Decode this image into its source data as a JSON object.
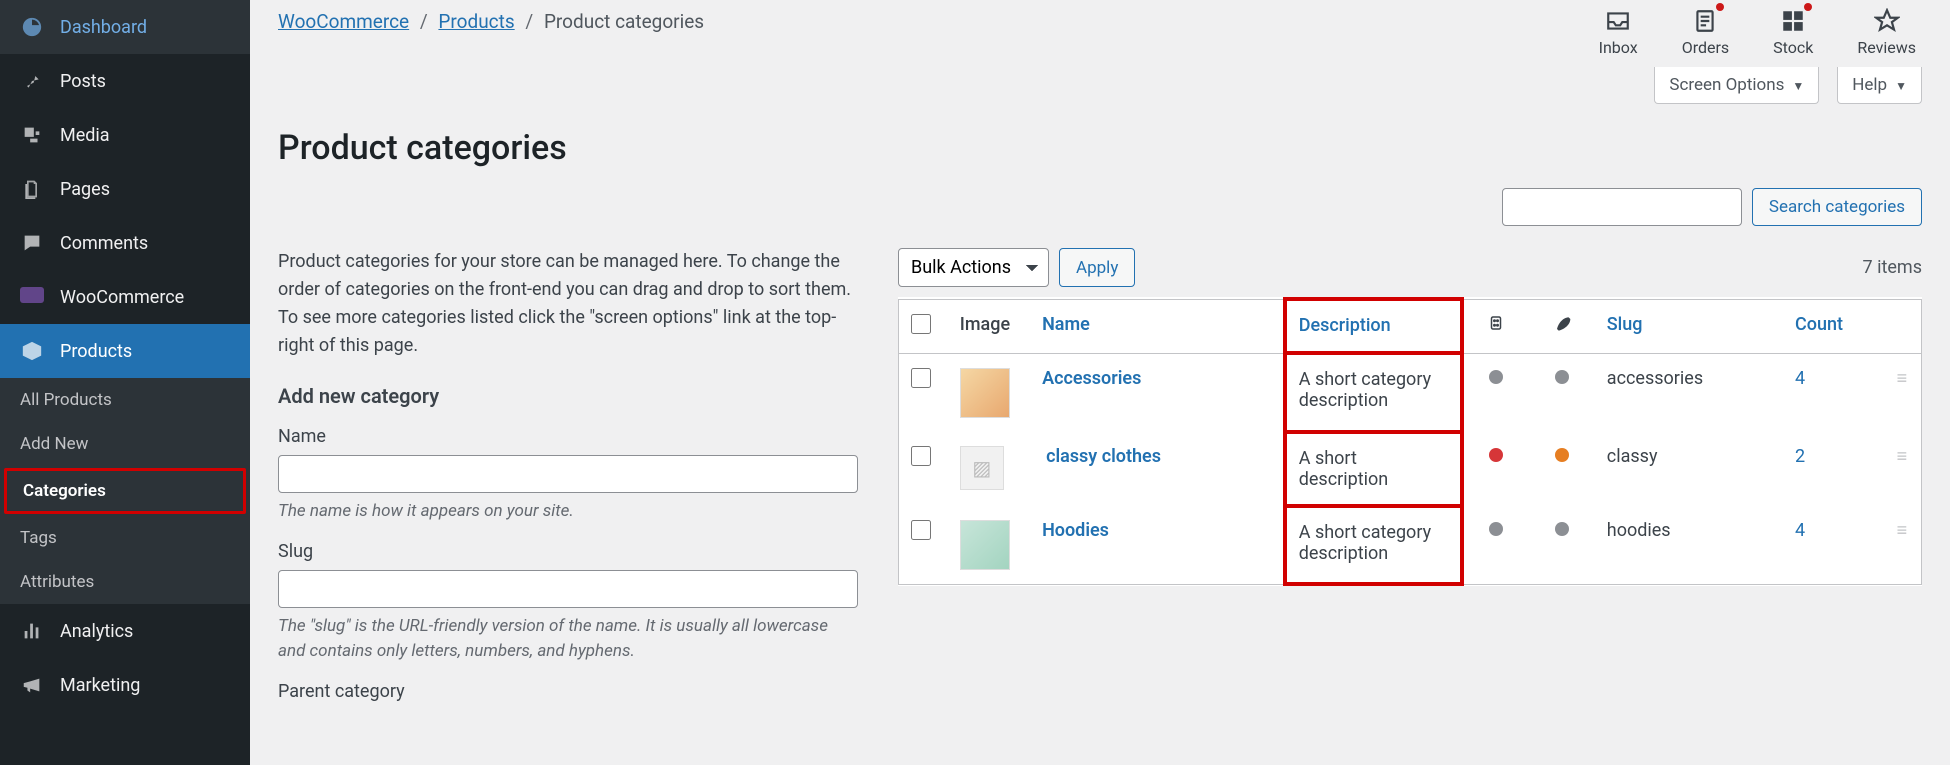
{
  "sidebar": {
    "items": [
      {
        "label": "Dashboard",
        "icon": "dashboard"
      },
      {
        "label": "Posts",
        "icon": "pin"
      },
      {
        "label": "Media",
        "icon": "media"
      },
      {
        "label": "Pages",
        "icon": "pages"
      },
      {
        "label": "Comments",
        "icon": "comments"
      },
      {
        "label": "WooCommerce",
        "icon": "woo"
      },
      {
        "label": "Products",
        "icon": "products"
      },
      {
        "label": "Analytics",
        "icon": "analytics"
      },
      {
        "label": "Marketing",
        "icon": "marketing"
      }
    ],
    "sub": [
      {
        "label": "All Products"
      },
      {
        "label": "Add New"
      },
      {
        "label": "Categories"
      },
      {
        "label": "Tags"
      },
      {
        "label": "Attributes"
      }
    ]
  },
  "breadcrumb": {
    "woo": "WooCommerce",
    "products": "Products",
    "current": "Product categories"
  },
  "topicons": [
    {
      "label": "Inbox",
      "icon": "inbox",
      "dot": false
    },
    {
      "label": "Orders",
      "icon": "orders",
      "dot": true
    },
    {
      "label": "Stock",
      "icon": "stock",
      "dot": true
    },
    {
      "label": "Reviews",
      "icon": "reviews",
      "dot": false
    }
  ],
  "screen_options": "Screen Options",
  "help": "Help",
  "page_title": "Product categories",
  "intro": "Product categories for your store can be managed here. To change the order of categories on the front-end you can drag and drop to sort them. To see more categories listed click the \"screen options\" link at the top-right of this page.",
  "form": {
    "heading": "Add new category",
    "name_label": "Name",
    "name_hint": "The name is how it appears on your site.",
    "slug_label": "Slug",
    "slug_hint": "The \"slug\" is the URL-friendly version of the name. It is usually all lowercase and contains only letters, numbers, and hyphens.",
    "parent_label": "Parent category"
  },
  "search_btn": "Search categories",
  "bulk_label": "Bulk Actions",
  "apply": "Apply",
  "items_count": "7 items",
  "cols": {
    "image": "Image",
    "name": "Name",
    "description": "Description",
    "slug": "Slug",
    "count": "Count"
  },
  "rows": [
    {
      "name": "Accessories",
      "desc": "A short category description",
      "slug": "accessories",
      "count": "4",
      "d1": "g",
      "d2": "g",
      "thumb": "t1",
      "indent": false
    },
    {
      "name": "classy clothes",
      "desc": "A short description",
      "slug": "classy",
      "count": "2",
      "d1": "r",
      "d2": "o",
      "thumb": "ph",
      "indent": true
    },
    {
      "name": "Hoodies",
      "desc": "A short category description",
      "slug": "hoodies",
      "count": "4",
      "d1": "g",
      "d2": "g",
      "thumb": "t3",
      "indent": false
    }
  ]
}
